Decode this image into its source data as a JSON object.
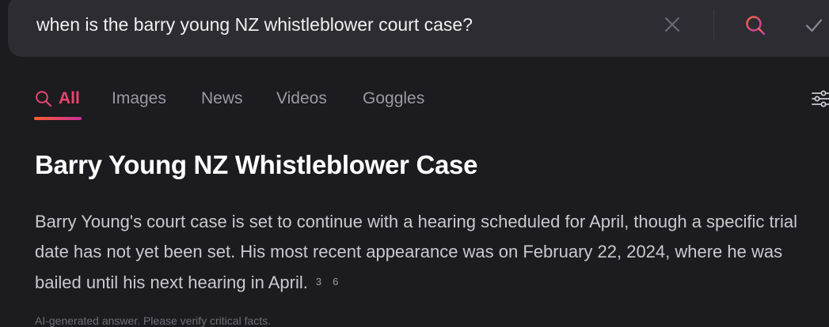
{
  "search": {
    "query": "when is the barry young NZ whistleblower court case?"
  },
  "tabs": [
    {
      "label": "All",
      "active": true
    },
    {
      "label": "Images",
      "active": false
    },
    {
      "label": "News",
      "active": false
    },
    {
      "label": "Videos",
      "active": false
    },
    {
      "label": "Goggles",
      "active": false
    }
  ],
  "answer": {
    "title": "Barry Young NZ Whistleblower Case",
    "body": "Barry Young's court case is set to continue with a hearing scheduled for April, though a specific trial date has not yet been set. His most recent appearance was on February 22, 2024, where he was bailed until his next hearing in April.",
    "citations": [
      "3",
      "6"
    ],
    "disclaimer": "AI-generated answer. Please verify critical facts."
  },
  "icons": {
    "clear": "close-icon",
    "search": "search-icon",
    "confirm": "check-icon",
    "tab_all": "search-icon",
    "filters": "sliders-icon"
  },
  "colors": {
    "background": "#1c1b20",
    "search_bar": "#2c2c32",
    "accent": "#e8466e"
  }
}
